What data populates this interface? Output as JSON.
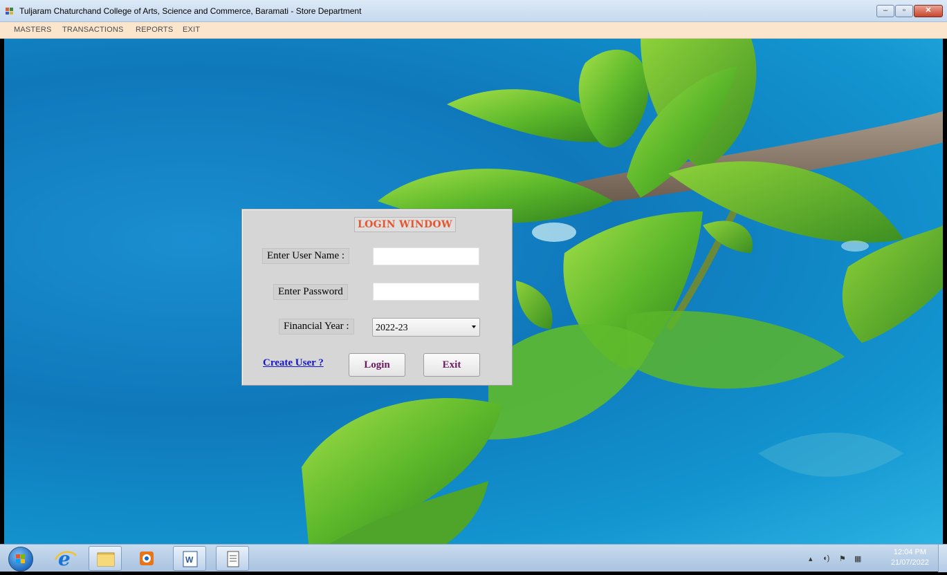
{
  "window": {
    "title": "Tuljaram Chaturchand College of Arts, Science and Commerce, Baramati - Store Department",
    "min_label": "–",
    "max_label": "▫",
    "close_label": "✕"
  },
  "menu": {
    "items": [
      "MASTERS",
      "TRANSACTIONS",
      "REPORTS",
      "EXIT"
    ]
  },
  "login": {
    "title": "LOGIN WINDOW",
    "username_label": "Enter User Name :",
    "username_value": "",
    "password_label": "Enter Password",
    "password_value": "",
    "year_label": "Financial Year :",
    "year_value": "2022-23",
    "create_user_link": "Create User ?",
    "login_button": "Login",
    "exit_button": "Exit"
  },
  "taskbar": {
    "apps": [
      "start-orb",
      "internet-explorer-icon",
      "file-explorer-icon",
      "media-player-icon",
      "word-icon",
      "document-icon"
    ],
    "clock_time": "12:04 PM",
    "clock_date": "21/07/2022"
  }
}
